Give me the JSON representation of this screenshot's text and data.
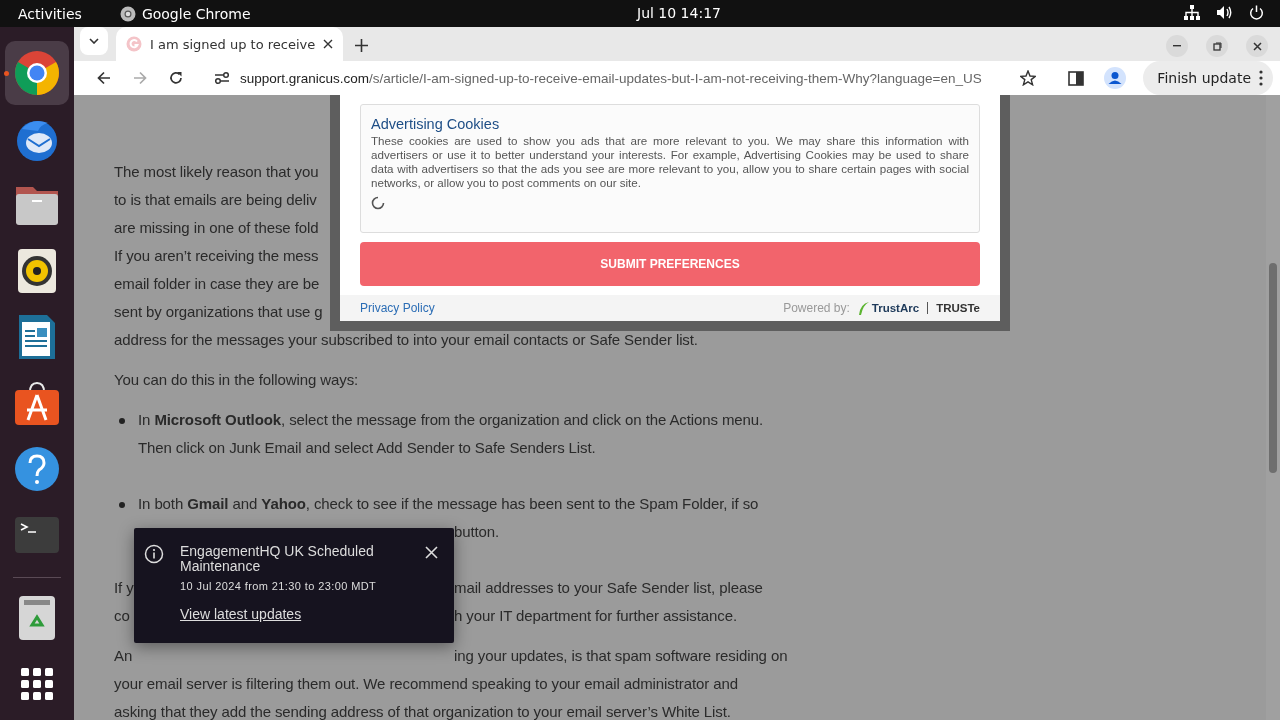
{
  "top_bar": {
    "activities": "Activities",
    "app_name": "Google Chrome",
    "clock": "Jul 10  14:17"
  },
  "dock": {
    "apps": [
      {
        "kind": "chrome",
        "selected": true
      },
      {
        "kind": "mail",
        "selected": false
      },
      {
        "kind": "files",
        "selected": false
      },
      {
        "kind": "music",
        "selected": false
      },
      {
        "kind": "writer",
        "selected": false
      },
      {
        "kind": "store",
        "selected": false
      },
      {
        "kind": "help",
        "selected": false
      },
      {
        "kind": "terminal",
        "selected": false
      },
      {
        "kind": "trash",
        "selected": false
      },
      {
        "kind": "grid",
        "selected": false
      }
    ]
  },
  "browser": {
    "tab": {
      "title": "I am signed up to receive"
    },
    "address": {
      "host": "support.granicus.com",
      "path": "/s/article/I-am-signed-up-to-receive-email-updates-but-I-am-not-receiving-them-Why?language=en_US"
    },
    "update_button": "Finish update"
  },
  "article": {
    "blocks": [
      {
        "kind": "paragraph",
        "lines": [
          {
            "left": "The most likely reason that you"
          },
          {
            "left": "to is that emails are being deliv"
          },
          {
            "left": "are missing in one of these fold"
          },
          {
            "left": "If you aren’t receiving the mess"
          },
          {
            "left": "email folder in case they are be"
          },
          {
            "left": "sent by organizations that use g"
          },
          {
            "left": "address for the messages your subscribed to into your email contacts or Safe Sender list."
          }
        ]
      },
      {
        "kind": "paragraph",
        "lines": [
          {
            "left": "You can do this in the following ways:"
          }
        ]
      },
      {
        "kind": "bullet",
        "lines": [
          {
            "left": "In **Microsoft Outlook**, select the message from the organization and click on the Actions menu."
          },
          {
            "left": "Then click on Junk Email and select Add Sender to Safe Senders List."
          }
        ]
      },
      {
        "kind": "bullet",
        "lines": [
          {
            "left": "In both **Gmail** and **Yahoo**, check to see if the message has been sent to the Spam Folder, if so"
          },
          {
            "right": "button."
          }
        ]
      },
      {
        "kind": "paragraph",
        "lines": [
          {
            "left": "If y",
            "right": "mail addresses to your Safe Sender list, please"
          },
          {
            "left": "co",
            "right": "h your IT department for further assistance."
          }
        ]
      },
      {
        "kind": "paragraph",
        "lines": [
          {
            "left": "An",
            "right": "ing your updates, is that spam software residing on"
          },
          {
            "left": "your email server is filtering them out. We recommend speaking to your email administrator and"
          },
          {
            "left": "asking that they add the sending address of that organization to your email server’s White List."
          }
        ]
      }
    ]
  },
  "cookie_dialog": {
    "section_title": "Advertising Cookies",
    "section_text": "These cookies are used to show you ads that are more relevant to you. We may share this information with advertisers or use it to better understand your interests. For example, Advertising Cookies may be used to share data with advertisers so that the ads you see are more relevant to you, allow you to share certain pages with social networks, or allow you to post comments on our site.",
    "submit_button": "SUBMIT PREFERENCES",
    "privacy_link": "Privacy Policy",
    "powered_by": "Powered by:",
    "brand": "TrustArc",
    "brand_2": "TRUSTe"
  },
  "toast": {
    "title": "EngagementHQ UK Scheduled Maintenance",
    "date": "10 Jul 2024 from 21:30 to 23:00 MDT",
    "link": "View latest updates"
  }
}
